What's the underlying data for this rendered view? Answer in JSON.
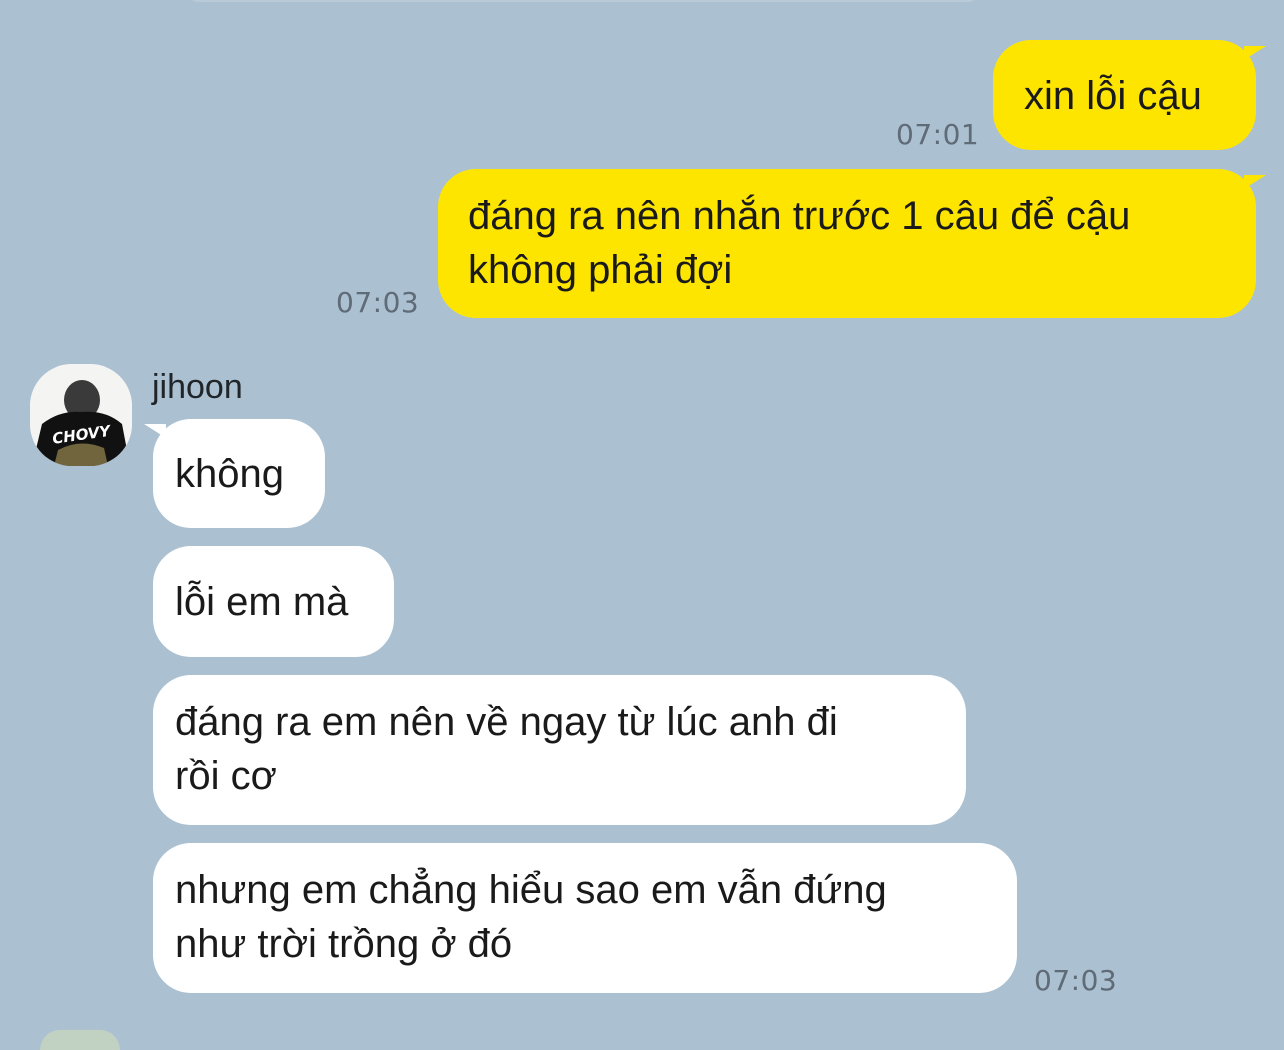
{
  "chat": {
    "messages": [
      {
        "sender": "me",
        "text": "xin lỗi cậu",
        "time": "07:01"
      },
      {
        "sender": "me",
        "text_lines": [
          "đáng ra nên nhắn trước 1 câu để cậu",
          "không phải đợi"
        ],
        "time": "07:03"
      },
      {
        "sender": "jihoon",
        "text": "không"
      },
      {
        "sender": "jihoon",
        "text": "lỗi em mà"
      },
      {
        "sender": "jihoon",
        "text_lines": [
          "đáng ra em nên về ngay từ lúc anh đi",
          "rồi cơ"
        ]
      },
      {
        "sender": "jihoon",
        "text_lines": [
          "nhưng em chẳng hiểu sao em vẫn đứng",
          "như trời trồng ở đó"
        ],
        "time": "07:03"
      }
    ],
    "contact": {
      "name": "jihoon",
      "avatar_icon": "profile-photo-icon",
      "avatar_shirt_text": "CHOVY"
    }
  },
  "colors": {
    "background": "#abc1d2",
    "outgoing_bubble": "#fee500",
    "incoming_bubble": "#ffffff"
  }
}
